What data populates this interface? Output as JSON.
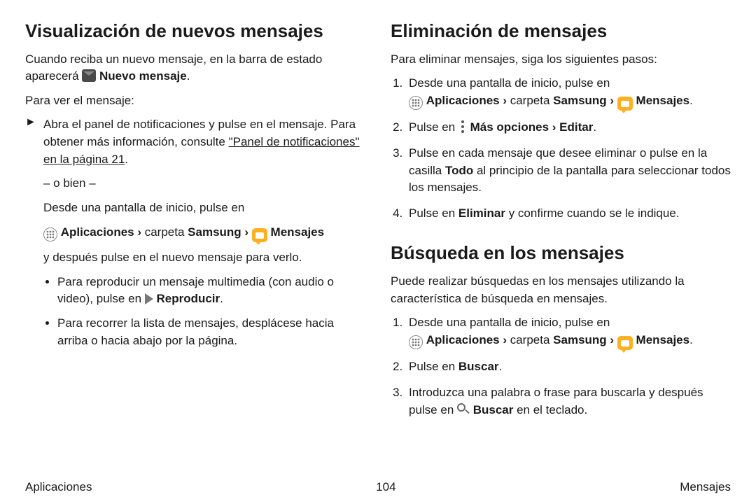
{
  "left": {
    "h1": "Visualización de nuevos mensajes",
    "intro_a": "Cuando reciba un nuevo mensaje, en la barra de estado aparecerá ",
    "intro_b": " Nuevo mensaje",
    "intro_c": ".",
    "lead": "Para ver el mensaje:",
    "notif_a": "Abra el panel de notificaciones y pulse en el mensaje. Para obtener más información, consulte ",
    "notif_link": "\"Panel de notificaciones\" en la página 21",
    "notif_b": ".",
    "or": "– o bien –",
    "home_a": "Desde una pantalla de inicio, pulse en",
    "path_apps": "Aplicaciones",
    "path_sep": " › ",
    "path_folder_a": "carpeta ",
    "path_folder_b": "Samsung",
    "path_msgs": "Mensajes",
    "home_tail": "y después pulse en el nuevo mensaje para verlo.",
    "bul1_a": "Para reproducir un mensaje multimedia (con audio o video), pulse en ",
    "bul1_b": " Reproducir",
    "bul1_c": ".",
    "bul2": "Para recorrer la lista de mensajes, desplácese hacia arriba o hacia abajo por la página."
  },
  "right": {
    "h1": "Eliminación de mensajes",
    "intro": "Para eliminar mensajes, siga los siguientes pasos:",
    "s1": "Desde una pantalla de inicio, pulse en",
    "path_apps": "Aplicaciones",
    "path_sep": " › ",
    "path_folder_a": "carpeta ",
    "path_folder_b": "Samsung",
    "path_msgs": "Mensajes",
    "s2_a": "Pulse en ",
    "s2_b": " Más opciones",
    "s2_c": "Editar",
    "s2_d": ".",
    "s3_a": "Pulse en cada mensaje que desee eliminar o pulse en la casilla ",
    "s3_b": "Todo",
    "s3_c": " al principio de la pantalla para seleccionar todos los mensajes.",
    "s4_a": "Pulse en ",
    "s4_b": "Eliminar",
    "s4_c": " y confirme cuando se le indique.",
    "h2": "Búsqueda en los mensajes",
    "search_intro": "Puede realizar búsquedas en los mensajes utilizando la característica de búsqueda en mensajes.",
    "b1": "Desde una pantalla de inicio, pulse en",
    "b2_a": "Pulse en ",
    "b2_b": "Buscar",
    "b2_c": ".",
    "b3_a": "Introduzca una palabra o frase para buscarla y después pulse en ",
    "b3_b": " Buscar",
    "b3_c": " en el teclado."
  },
  "footer": {
    "left": "Aplicaciones",
    "center": "104",
    "right": "Mensajes"
  }
}
